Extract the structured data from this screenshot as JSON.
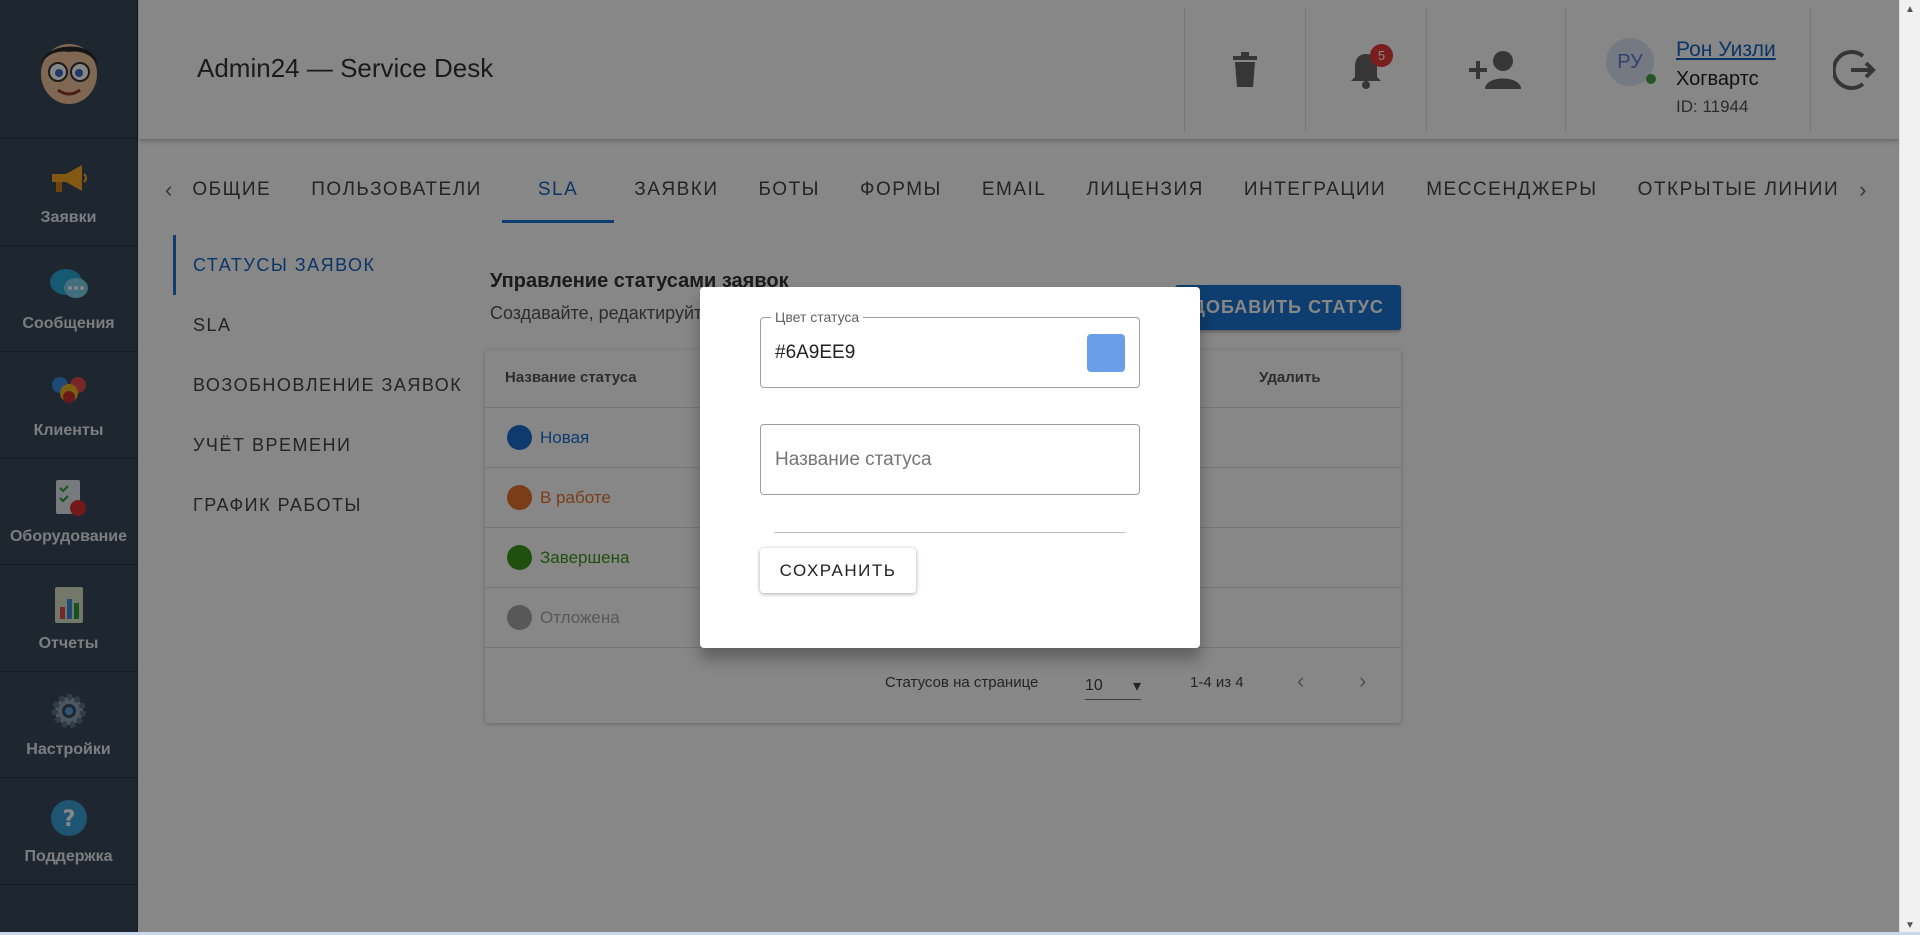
{
  "header": {
    "title": "Admin24 — Service Desk",
    "notifications_count": "5",
    "user": {
      "initials": "РУ",
      "name": "Рон Уизли",
      "org": "Хогвартс",
      "id": "ID: 11944"
    }
  },
  "sidebar": {
    "items": [
      {
        "label": "Заявки",
        "icon": "megaphone-icon"
      },
      {
        "label": "Сообщения",
        "icon": "chat-bubbles-icon"
      },
      {
        "label": "Клиенты",
        "icon": "people-icon"
      },
      {
        "label": "Оборудование",
        "icon": "checklist-icon"
      },
      {
        "label": "Отчеты",
        "icon": "report-chart-icon"
      },
      {
        "label": "Настройки",
        "icon": "gear-icon"
      },
      {
        "label": "Поддержка",
        "icon": "help-icon"
      }
    ]
  },
  "tabs": [
    "ОБЩИЕ",
    "ПОЛЬЗОВАТЕЛИ",
    "SLA",
    "ЗАЯВКИ",
    "БОТЫ",
    "ФОРМЫ",
    "EMAIL",
    "ЛИЦЕНЗИЯ",
    "ИНТЕГРАЦИИ",
    "МЕССЕНДЖЕРЫ",
    "ОТКРЫТЫЕ ЛИНИИ"
  ],
  "active_tab": "SLA",
  "subnav": [
    "СТАТУСЫ ЗАЯВОК",
    "SLA",
    "ВОЗОБНОВЛЕНИЕ ЗАЯВОК",
    "УЧЁТ ВРЕМЕНИ",
    "ГРАФИК РАБОТЫ"
  ],
  "content": {
    "title": "Управление статусами заявок",
    "subtitle": "Создавайте, редактируйте",
    "add_button": "ДОБАВИТЬ СТАТУС",
    "table": {
      "col_name": "Название статуса",
      "col_delete": "Удалить",
      "rows": [
        {
          "name": "Новая",
          "color": "#1e6fd0"
        },
        {
          "name": "В работе",
          "color": "#e9722e"
        },
        {
          "name": "Завершена",
          "color": "#3a9a1c"
        },
        {
          "name": "Отложена",
          "color": "#a6a6a6"
        }
      ],
      "per_page_label": "Статусов на странице",
      "per_page_value": "10",
      "range": "1-4 из 4"
    }
  },
  "modal": {
    "color_label": "Цвет статуса",
    "color_value": "#6A9EE9",
    "name_placeholder": "Название статуса",
    "save_label": "СОХРАНИТЬ"
  },
  "colors": {
    "accent": "#1976d2",
    "sidebar": "#3a4a5c",
    "overlay": "rgba(0,0,0,0.47)"
  }
}
